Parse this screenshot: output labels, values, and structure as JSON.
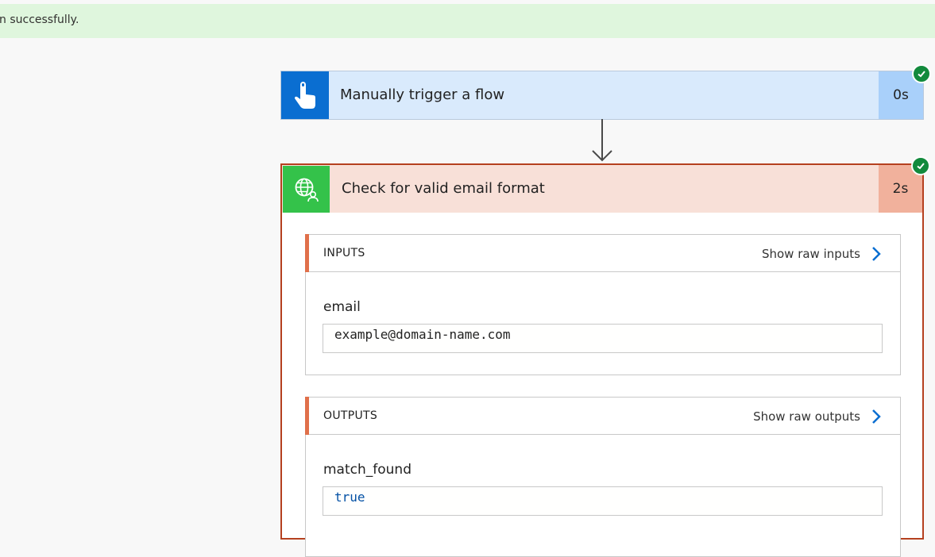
{
  "banner": {
    "text": "n successfully."
  },
  "trigger": {
    "title": "Manually trigger a flow",
    "duration": "0s",
    "icon": "touch-hand-icon",
    "status": "succeeded"
  },
  "action": {
    "title": "Check for valid email format",
    "duration": "2s",
    "icon": "globe-person-icon",
    "status": "succeeded",
    "inputs": {
      "title": "INPUTS",
      "raw_link": "Show raw inputs",
      "fields": [
        {
          "label": "email",
          "value": "example@domain-name.com"
        }
      ]
    },
    "outputs": {
      "title": "OUTPUTS",
      "raw_link": "Show raw outputs",
      "fields": [
        {
          "label": "match_found",
          "value": "true"
        }
      ]
    }
  },
  "colors": {
    "banner_bg": "#dff6dd",
    "trigger_bg": "#d9eafc",
    "trigger_icon_bg": "#0a6ed1",
    "action_border": "#b5401f",
    "action_icon_bg": "#34c24a",
    "success_green": "#128a3c",
    "link_blue": "#0a6ed1",
    "bool_blue": "#0451a5"
  }
}
